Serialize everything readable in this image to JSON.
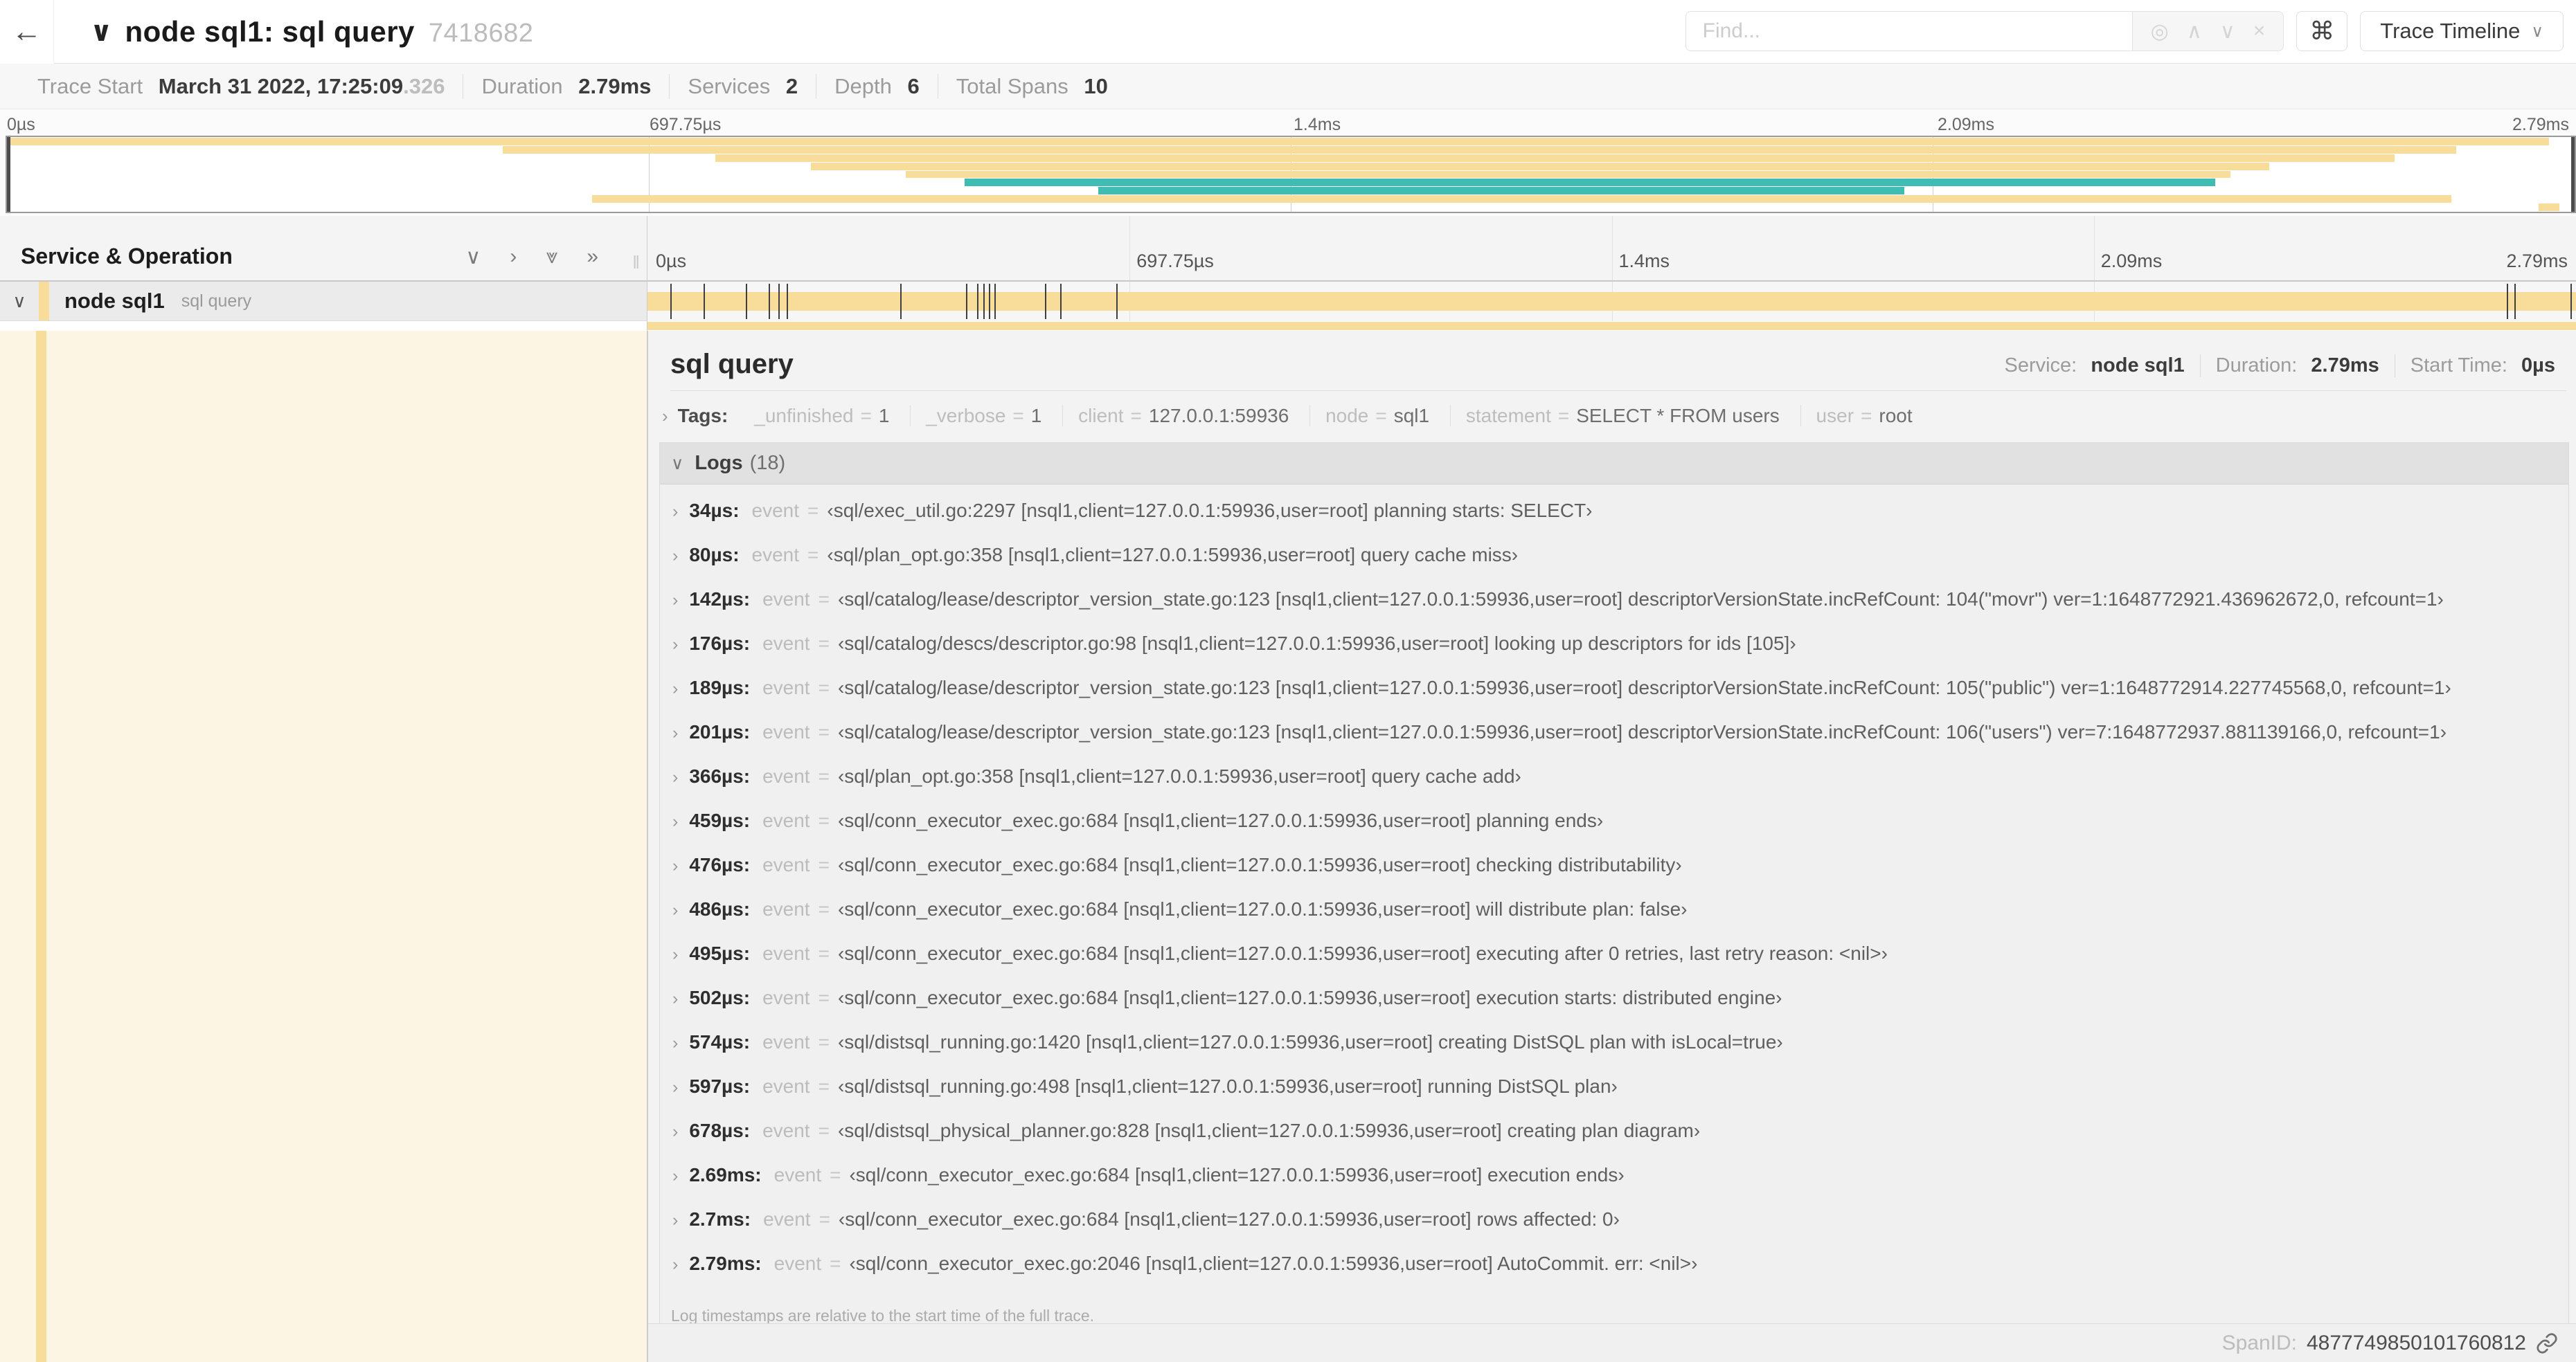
{
  "header": {
    "back_icon": "←",
    "collapse_chevron": "∨",
    "title": "node sql1: sql query",
    "trace_id": "7418682",
    "find": {
      "placeholder": "Find...",
      "icons": {
        "target": "◎",
        "prev": "∧",
        "next": "∨",
        "clear": "×"
      }
    },
    "shortcut_icon": "⌘",
    "view_button": {
      "label": "Trace Timeline",
      "caret": "∨"
    }
  },
  "trace_info": {
    "items": [
      {
        "label": "Trace Start",
        "value": "March 31 2022, 17:25:09",
        "suffix": ".326"
      },
      {
        "label": "Duration",
        "value": "2.79ms",
        "suffix": ""
      },
      {
        "label": "Services",
        "value": "2",
        "suffix": ""
      },
      {
        "label": "Depth",
        "value": "6",
        "suffix": ""
      },
      {
        "label": "Total Spans",
        "value": "10",
        "suffix": ""
      }
    ]
  },
  "minimap": {
    "ticks": [
      "0µs",
      "697.75µs",
      "1.4ms",
      "2.09ms",
      "2.79ms"
    ],
    "bars": [
      {
        "top": "1%",
        "left": "0%",
        "width": "99%",
        "color": "#f7dc9a"
      },
      {
        "top": "12%",
        "left": "19.3%",
        "width": "76.1%",
        "color": "#f7dc9a"
      },
      {
        "top": "23%",
        "left": "27.6%",
        "width": "65.4%",
        "color": "#f7dc9a"
      },
      {
        "top": "34%",
        "left": "31.3%",
        "width": "56.8%",
        "color": "#f7dc9a"
      },
      {
        "top": "45%",
        "left": "35.0%",
        "width": "51.6%",
        "color": "#f7dc9a"
      },
      {
        "top": "56%",
        "left": "37.3%",
        "width": "48.7%",
        "color": "#3fbdb3"
      },
      {
        "top": "67%",
        "left": "42.5%",
        "width": "31.4%",
        "color": "#3fbdb3"
      },
      {
        "top": "78%",
        "left": "22.8%",
        "width": "72.4%",
        "color": "#f7dc9a"
      },
      {
        "top": "89%",
        "left": "98.6%",
        "width": "0.8%",
        "color": "#f7dc9a"
      }
    ]
  },
  "timeline": {
    "left_header": "Service & Operation",
    "toolbar_icons": {
      "collapse_one": "∨",
      "expand_one": "›",
      "collapse_all": "⩔",
      "expand_all": "»"
    },
    "resizer_grip": "‖",
    "ticks": [
      "0µs",
      "697.75µs",
      "1.4ms",
      "2.09ms",
      "2.79ms"
    ],
    "row": {
      "expander": "∨",
      "service": "node sql1",
      "operation": "sql query"
    },
    "markers": [
      {
        "left": "1.2%"
      },
      {
        "left": "2.9%"
      },
      {
        "left": "5.1%"
      },
      {
        "left": "6.3%"
      },
      {
        "left": "6.8%"
      },
      {
        "left": "7.2%"
      },
      {
        "left": "13.1%"
      },
      {
        "left": "16.5%"
      },
      {
        "left": "17.1%"
      },
      {
        "left": "17.4%"
      },
      {
        "left": "17.7%"
      },
      {
        "left": "18.0%"
      },
      {
        "left": "20.6%"
      },
      {
        "left": "21.4%"
      },
      {
        "left": "24.3%"
      },
      {
        "left": "96.4%"
      },
      {
        "left": "96.8%"
      },
      {
        "left": "99.7%"
      }
    ]
  },
  "detail": {
    "title": "sql query",
    "meta": [
      {
        "label": "Service:",
        "value": "node sql1"
      },
      {
        "label": "Duration:",
        "value": "2.79ms"
      },
      {
        "label": "Start Time:",
        "value": "0µs"
      }
    ],
    "tags": {
      "chevron": "›",
      "label": "Tags:",
      "eq": "=",
      "items": [
        {
          "key": "_unfinished",
          "value": "1"
        },
        {
          "key": "_verbose",
          "value": "1"
        },
        {
          "key": "client",
          "value": "127.0.0.1:59936"
        },
        {
          "key": "node",
          "value": "sql1"
        },
        {
          "key": "statement",
          "value": "SELECT * FROM users"
        },
        {
          "key": "user",
          "value": "root"
        }
      ]
    },
    "logs": {
      "chevron": "∨",
      "title": "Logs",
      "count": "(18)",
      "row_chevron": "›",
      "field_label": "event",
      "eq": "=",
      "entries": [
        {
          "time": "34µs",
          "value": "‹sql/exec_util.go:2297 [nsql1,client=127.0.0.1:59936,user=root] planning starts: SELECT›"
        },
        {
          "time": "80µs",
          "value": "‹sql/plan_opt.go:358 [nsql1,client=127.0.0.1:59936,user=root] query cache miss›"
        },
        {
          "time": "142µs",
          "value": "‹sql/catalog/lease/descriptor_version_state.go:123 [nsql1,client=127.0.0.1:59936,user=root] descriptorVersionState.incRefCount: 104(\"movr\") ver=1:1648772921.436962672,0, refcount=1›"
        },
        {
          "time": "176µs",
          "value": "‹sql/catalog/descs/descriptor.go:98 [nsql1,client=127.0.0.1:59936,user=root] looking up descriptors for ids [105]›"
        },
        {
          "time": "189µs",
          "value": "‹sql/catalog/lease/descriptor_version_state.go:123 [nsql1,client=127.0.0.1:59936,user=root] descriptorVersionState.incRefCount: 105(\"public\") ver=1:1648772914.227745568,0, refcount=1›"
        },
        {
          "time": "201µs",
          "value": "‹sql/catalog/lease/descriptor_version_state.go:123 [nsql1,client=127.0.0.1:59936,user=root] descriptorVersionState.incRefCount: 106(\"users\") ver=7:1648772937.881139166,0, refcount=1›"
        },
        {
          "time": "366µs",
          "value": "‹sql/plan_opt.go:358 [nsql1,client=127.0.0.1:59936,user=root] query cache add›"
        },
        {
          "time": "459µs",
          "value": "‹sql/conn_executor_exec.go:684 [nsql1,client=127.0.0.1:59936,user=root] planning ends›"
        },
        {
          "time": "476µs",
          "value": "‹sql/conn_executor_exec.go:684 [nsql1,client=127.0.0.1:59936,user=root] checking distributability›"
        },
        {
          "time": "486µs",
          "value": "‹sql/conn_executor_exec.go:684 [nsql1,client=127.0.0.1:59936,user=root] will distribute plan: false›"
        },
        {
          "time": "495µs",
          "value": "‹sql/conn_executor_exec.go:684 [nsql1,client=127.0.0.1:59936,user=root] executing after 0 retries, last retry reason: <nil>›"
        },
        {
          "time": "502µs",
          "value": "‹sql/conn_executor_exec.go:684 [nsql1,client=127.0.0.1:59936,user=root] execution starts: distributed engine›"
        },
        {
          "time": "574µs",
          "value": "‹sql/distsql_running.go:1420 [nsql1,client=127.0.0.1:59936,user=root] creating DistSQL plan with isLocal=true›"
        },
        {
          "time": "597µs",
          "value": "‹sql/distsql_running.go:498 [nsql1,client=127.0.0.1:59936,user=root] running DistSQL plan›"
        },
        {
          "time": "678µs",
          "value": "‹sql/distsql_physical_planner.go:828 [nsql1,client=127.0.0.1:59936,user=root] creating plan diagram›"
        },
        {
          "time": "2.69ms",
          "value": "‹sql/conn_executor_exec.go:684 [nsql1,client=127.0.0.1:59936,user=root] execution ends›"
        },
        {
          "time": "2.7ms",
          "value": "‹sql/conn_executor_exec.go:684 [nsql1,client=127.0.0.1:59936,user=root] rows affected: 0›"
        },
        {
          "time": "2.79ms",
          "value": "‹sql/conn_executor_exec.go:2046 [nsql1,client=127.0.0.1:59936,user=root] AutoCommit. err: <nil>›"
        }
      ],
      "footnote": "Log timestamps are relative to the start time of the full trace."
    },
    "footer": {
      "span_id_label": "SpanID:",
      "span_id": "4877749850101760812"
    }
  },
  "colors": {
    "span_orange": "#f7dc9a",
    "span_teal": "#3fbdb3",
    "detail_cream": "#fdf5e3"
  }
}
